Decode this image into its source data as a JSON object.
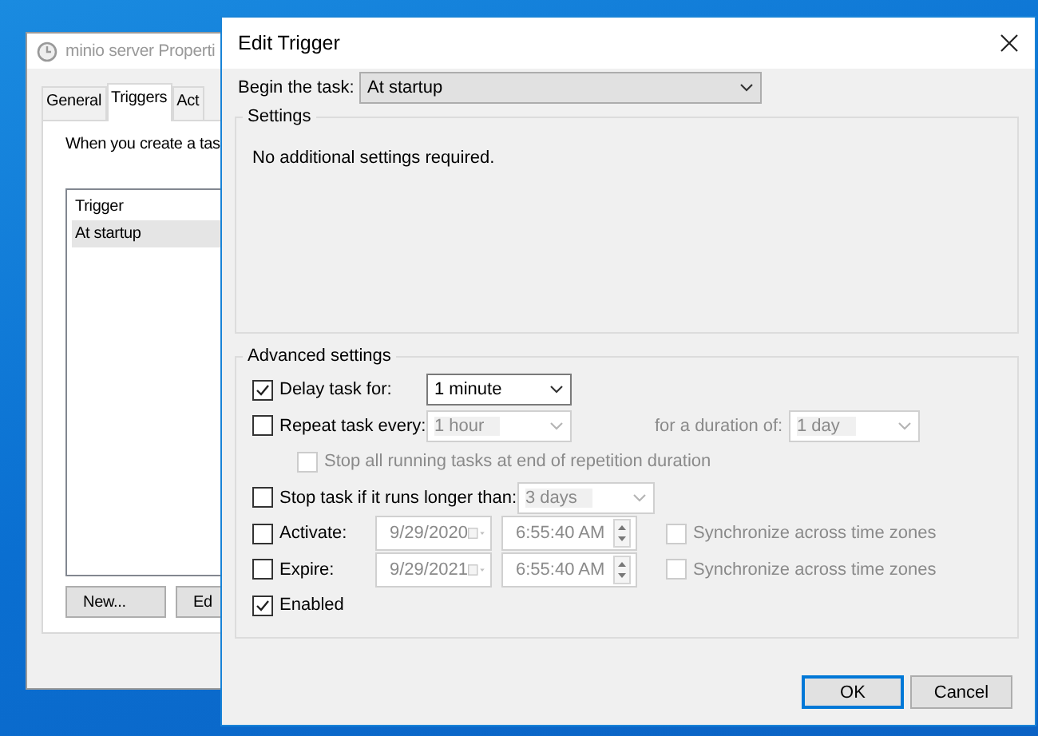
{
  "back_window": {
    "title": "minio server Properti",
    "tabs": [
      {
        "label": "General",
        "selected": false
      },
      {
        "label": "Triggers",
        "selected": true
      },
      {
        "label": "Act",
        "selected": false
      }
    ],
    "description": "When you create a tas",
    "list_header": "Trigger",
    "rows": [
      {
        "label": "At startup",
        "selected": true
      }
    ],
    "buttons": [
      "New...",
      "Ed"
    ]
  },
  "dialog": {
    "title": "Edit Trigger",
    "begin_label": "Begin the task:",
    "begin_value": "At startup",
    "settings": {
      "title": "Settings",
      "message": "No additional settings required."
    },
    "advanced": {
      "title": "Advanced settings",
      "delay": {
        "label": "Delay task for:",
        "checked": true,
        "value": "1 minute",
        "disabled": false
      },
      "repeat": {
        "label": "Repeat task every:",
        "checked": false,
        "value": "1 hour",
        "disabled": true,
        "duration_label": "for a duration of:",
        "duration_value": "1 day"
      },
      "stop_all": {
        "label": "Stop all running tasks at end of repetition duration",
        "checked": false,
        "disabled": true
      },
      "stop_longer": {
        "label": "Stop task if it runs longer than:",
        "checked": false,
        "value": "3 days",
        "disabled": true
      },
      "dates": [
        {
          "label": "Activate:",
          "checked": false,
          "date": "9/29/2020",
          "time": "6:55:40 AM",
          "sync_label": "Synchronize across time zones",
          "sync_checked": false,
          "disabled": true
        },
        {
          "label": "Expire:",
          "checked": false,
          "date": "9/29/2021",
          "time": "6:55:40 AM",
          "sync_label": "Synchronize across time zones",
          "sync_checked": false,
          "disabled": true
        }
      ],
      "enabled": {
        "label": "Enabled",
        "checked": true
      }
    },
    "buttons": [
      {
        "label": "OK",
        "default": true
      },
      {
        "label": "Cancel",
        "default": false
      }
    ]
  }
}
